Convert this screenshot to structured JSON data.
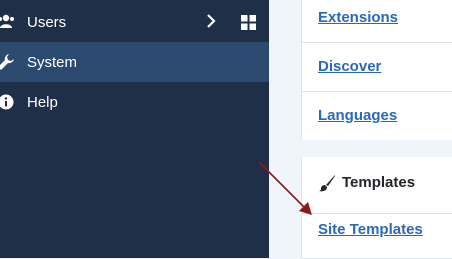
{
  "sidebar": {
    "items": [
      {
        "label": "Users",
        "icon": "users-icon"
      },
      {
        "label": "System",
        "icon": "wrench-icon"
      },
      {
        "label": "Help",
        "icon": "info-icon"
      }
    ]
  },
  "panel": {
    "links_top": [
      "Extensions",
      "Discover",
      "Languages"
    ],
    "templates_header": "Templates",
    "templates_links": [
      "Site Templates"
    ]
  },
  "colors": {
    "sidebar_bg": "#1e2f47",
    "sidebar_active": "#2c4a70",
    "link": "#2a69b8",
    "arrow": "#8b1a1a"
  }
}
